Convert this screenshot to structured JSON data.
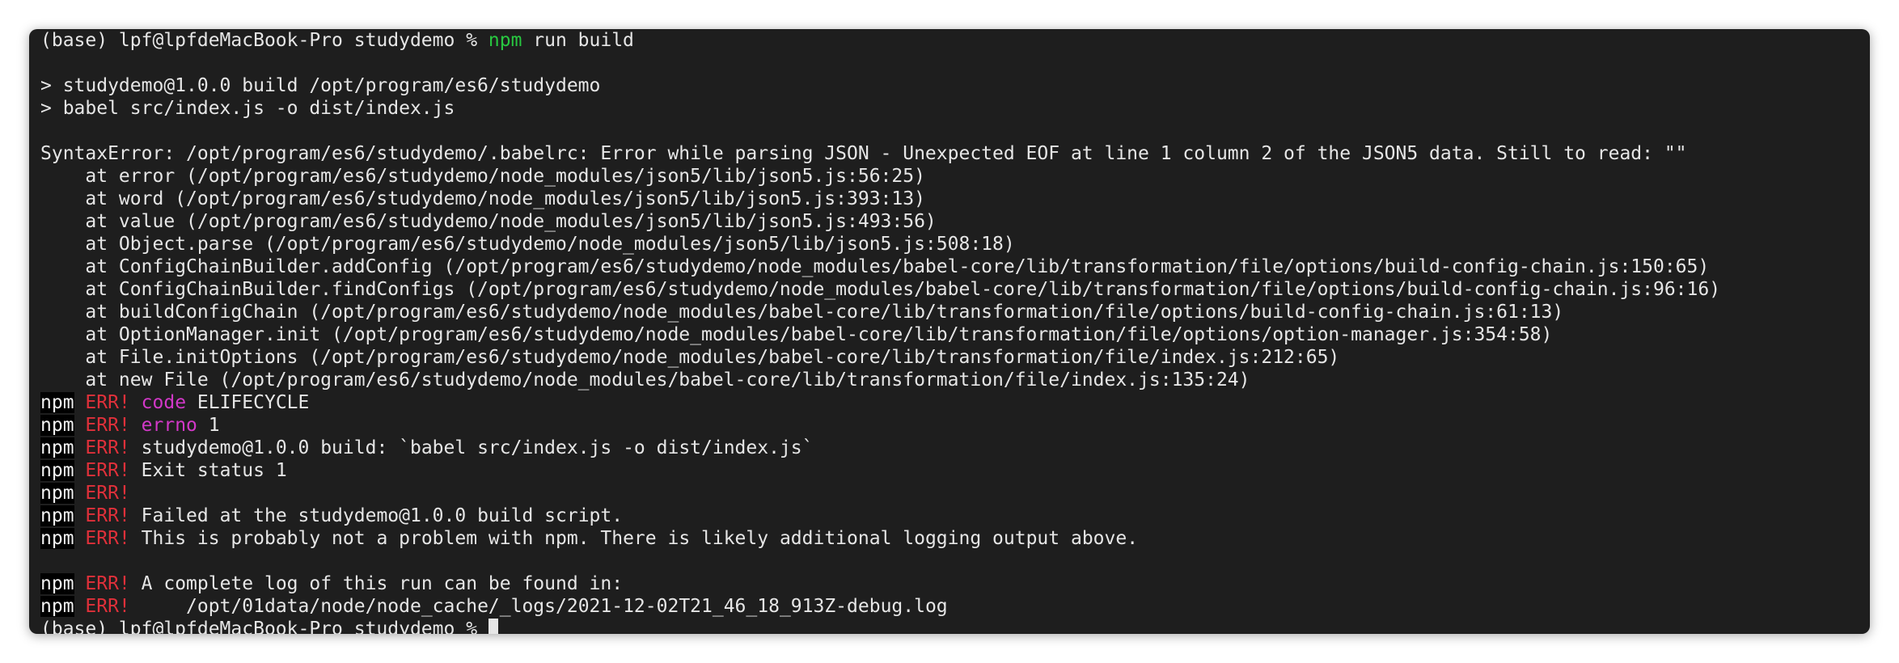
{
  "terminal": {
    "prompt": "(base) lpf@lpfdeMacBook-Pro studydemo % ",
    "command_program": "npm",
    "command_args": " run build",
    "script_lines": [
      "> studydemo@1.0.0 build /opt/program/es6/studydemo",
      "> babel src/index.js -o dist/index.js"
    ],
    "error_header": "SyntaxError: /opt/program/es6/studydemo/.babelrc: Error while parsing JSON - Unexpected EOF at line 1 column 2 of the JSON5 data. Still to read: \"\"",
    "stack": [
      "    at error (/opt/program/es6/studydemo/node_modules/json5/lib/json5.js:56:25)",
      "    at word (/opt/program/es6/studydemo/node_modules/json5/lib/json5.js:393:13)",
      "    at value (/opt/program/es6/studydemo/node_modules/json5/lib/json5.js:493:56)",
      "    at Object.parse (/opt/program/es6/studydemo/node_modules/json5/lib/json5.js:508:18)",
      "    at ConfigChainBuilder.addConfig (/opt/program/es6/studydemo/node_modules/babel-core/lib/transformation/file/options/build-config-chain.js:150:65)",
      "    at ConfigChainBuilder.findConfigs (/opt/program/es6/studydemo/node_modules/babel-core/lib/transformation/file/options/build-config-chain.js:96:16)",
      "    at buildConfigChain (/opt/program/es6/studydemo/node_modules/babel-core/lib/transformation/file/options/build-config-chain.js:61:13)",
      "    at OptionManager.init (/opt/program/es6/studydemo/node_modules/babel-core/lib/transformation/file/options/option-manager.js:354:58)",
      "    at File.initOptions (/opt/program/es6/studydemo/node_modules/babel-core/lib/transformation/file/index.js:212:65)",
      "    at new File (/opt/program/es6/studydemo/node_modules/babel-core/lib/transformation/file/index.js:135:24)"
    ],
    "npm_label": "npm",
    "err_label": "ERR!",
    "npm_errors": {
      "code_key": "code",
      "code_value": " ELIFECYCLE",
      "errno_key": "errno",
      "errno_value": " 1",
      "build_line": "studydemo@1.0.0 build: `babel src/index.js -o dist/index.js`",
      "exit_status": "Exit status 1",
      "failed_at": "Failed at the studydemo@1.0.0 build script.",
      "not_npm": "This is probably not a problem with npm. There is likely additional logging output above.",
      "log_intro": "A complete log of this run can be found in:",
      "log_path": "    /opt/01data/node/node_cache/_logs/2021-12-02T21_46_18_913Z-debug.log"
    },
    "colors": {
      "background": "#1e1e1e",
      "text": "#e6e6e6",
      "command": "#28c840",
      "err": "#e0303a",
      "key": "#d238c8"
    }
  }
}
